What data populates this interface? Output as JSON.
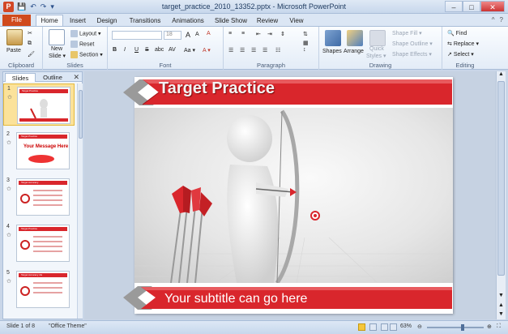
{
  "window": {
    "title": "target_practice_2010_13352.pptx  -  Microsoft PowerPoint",
    "app_icon": "P",
    "quick_access": [
      "save-icon",
      "undo-icon",
      "redo-icon",
      "customize-icon"
    ],
    "controls": {
      "minimize": "–",
      "maximize": "□",
      "close": "✕"
    }
  },
  "tabs": {
    "file": "File",
    "items": [
      "Home",
      "Insert",
      "Design",
      "Transitions",
      "Animations",
      "Slide Show",
      "Review",
      "View"
    ],
    "active": "Home",
    "right_controls": [
      "^",
      "?"
    ]
  },
  "ribbon": {
    "clipboard": {
      "label": "Clipboard",
      "paste": "Paste"
    },
    "slides": {
      "label": "Slides",
      "new_slide": "New",
      "new_slide2": "Slide ▾",
      "layout": "Layout ▾",
      "reset": "Reset",
      "section": "Section ▾"
    },
    "font": {
      "label": "Font",
      "size": "18",
      "grow": "A",
      "shrink": "A",
      "clear": "A",
      "bold": "B",
      "italic": "I",
      "underline": "U",
      "strike": "S",
      "shadow": "abc",
      "spacing": "AV",
      "case": "Aa ▾",
      "color": "A ▾"
    },
    "paragraph": {
      "label": "Paragraph"
    },
    "drawing": {
      "label": "Drawing",
      "shapes": "Shapes",
      "arrange": "Arrange",
      "quick_styles": "Quick",
      "quick_styles2": "Styles ▾",
      "shape_fill": "Shape Fill ▾",
      "shape_outline": "Shape Outline ▾",
      "shape_effects": "Shape Effects ▾"
    },
    "editing": {
      "label": "Editing",
      "find": "Find",
      "replace": "Replace ▾",
      "select": "Select ▾"
    }
  },
  "left_pane": {
    "tabs": [
      "Slides",
      "Outline"
    ],
    "active_tab": "Slides",
    "close": "✕",
    "thumbnails": [
      {
        "number": "1",
        "marker": "✩",
        "title": "Target Practice"
      },
      {
        "number": "2",
        "marker": "✩",
        "title": "Target Practice",
        "banner": "Your Message Here"
      },
      {
        "number": "3",
        "marker": "✩",
        "title": "Target Accuracy"
      },
      {
        "number": "4",
        "marker": "✩",
        "title": "Target Practice"
      },
      {
        "number": "5",
        "marker": "✩",
        "title": "Target Accuracy 4G"
      }
    ]
  },
  "slide": {
    "title": "Target Practice",
    "subtitle": "Your subtitle can go here"
  },
  "status": {
    "slide_info": "Slide 1 of 8",
    "theme": "\"Office Theme\"",
    "zoom": "63%",
    "zoom_fraction": 0.63
  },
  "colors": {
    "accent_red": "#d9262c",
    "file_tab": "#d04a1d"
  }
}
